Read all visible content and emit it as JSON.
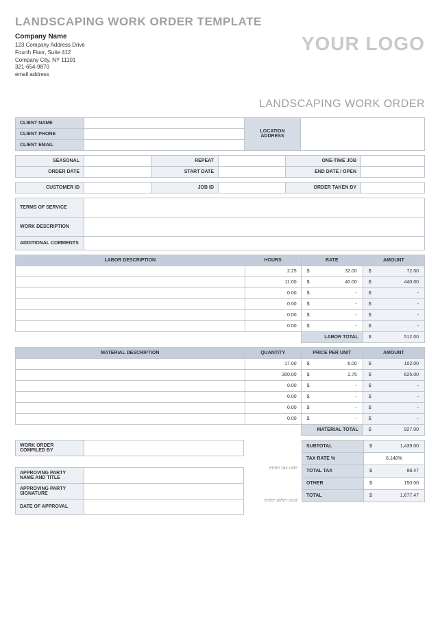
{
  "main_title": "LANDSCAPING WORK ORDER TEMPLATE",
  "logo_text": "YOUR LOGO",
  "sub_title": "LANDSCAPING WORK ORDER",
  "company": {
    "name": "Company Name",
    "addr1": "123 Company Address Drive",
    "addr2": "Fourth Floor, Suite 412",
    "addr3": "Company City, NY  11101",
    "phone": "321-654-9870",
    "email": "email address"
  },
  "labels": {
    "client_name": "CLIENT NAME",
    "client_phone": "CLIENT PHONE",
    "client_email": "CLIENT EMAIL",
    "location_address": "LOCATION ADDRESS",
    "seasonal": "SEASONAL",
    "repeat": "REPEAT",
    "one_time": "ONE-TIME JOB",
    "order_date": "ORDER DATE",
    "start_date": "START DATE",
    "end_date": "END DATE / OPEN",
    "customer_id": "CUSTOMER ID",
    "job_id": "JOB ID",
    "order_taken_by": "ORDER TAKEN BY",
    "terms": "TERMS OF SERVICE",
    "work_desc": "WORK DESCRIPTION",
    "additional": "ADDITIONAL COMMENTS",
    "labor_desc": "LABOR DESCRIPTION",
    "hours": "HOURS",
    "rate": "RATE",
    "amount": "AMOUNT",
    "labor_total": "LABOR TOTAL",
    "material_desc": "MATERIAL DESCRIPTION",
    "quantity": "QUANTITY",
    "ppu": "PRICE PER UNIT",
    "material_total": "MATERIAL TOTAL",
    "compiled_by": "WORK ORDER COMPILED BY",
    "approving_name": "APPROVING PARTY NAME AND TITLE",
    "approving_sig": "APPROVING PARTY SIGNATURE",
    "date_approval": "DATE OF APPROVAL",
    "subtotal": "SUBTOTAL",
    "tax_rate": "TAX RATE %",
    "total_tax": "TOTAL TAX",
    "other": "OTHER",
    "total": "TOTAL",
    "enter_tax": "enter tax rate",
    "enter_other": "enter other cost"
  },
  "currency": "$",
  "labor": [
    {
      "desc": "",
      "hours": "2.25",
      "rate": "32.00",
      "amount": "72.00"
    },
    {
      "desc": "",
      "hours": "11.00",
      "rate": "40.00",
      "amount": "440.00"
    },
    {
      "desc": "",
      "hours": "0.00",
      "rate": "-",
      "amount": "-"
    },
    {
      "desc": "",
      "hours": "0.00",
      "rate": "-",
      "amount": "-"
    },
    {
      "desc": "",
      "hours": "0.00",
      "rate": "-",
      "amount": "-"
    },
    {
      "desc": "",
      "hours": "0.00",
      "rate": "-",
      "amount": "-"
    }
  ],
  "labor_total": "512.00",
  "materials": [
    {
      "desc": "",
      "qty": "17.00",
      "ppu": "6.00",
      "amount": "102.00"
    },
    {
      "desc": "",
      "qty": "300.00",
      "ppu": "2.75",
      "amount": "825.00"
    },
    {
      "desc": "",
      "qty": "0.00",
      "ppu": "-",
      "amount": "-"
    },
    {
      "desc": "",
      "qty": "0.00",
      "ppu": "-",
      "amount": "-"
    },
    {
      "desc": "",
      "qty": "0.00",
      "ppu": "-",
      "amount": "-"
    },
    {
      "desc": "",
      "qty": "0.00",
      "ppu": "-",
      "amount": "-"
    }
  ],
  "material_total": "927.00",
  "totals": {
    "subtotal": "1,439.00",
    "tax_rate": "6.148%",
    "total_tax": "88.47",
    "other": "150.00",
    "total": "1,677.47"
  }
}
